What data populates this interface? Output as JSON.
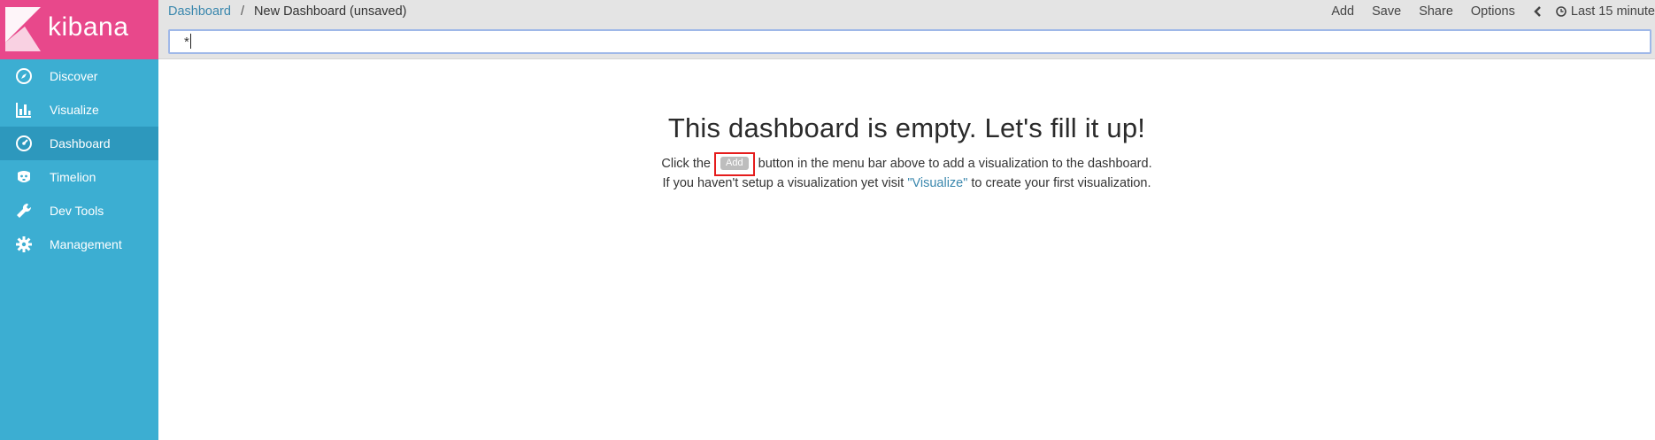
{
  "app": {
    "logo_text": "kibana"
  },
  "sidebar": {
    "items": [
      {
        "label": "Discover",
        "icon": "compass-icon"
      },
      {
        "label": "Visualize",
        "icon": "bar-chart-icon"
      },
      {
        "label": "Dashboard",
        "icon": "dashboard-icon",
        "active": true
      },
      {
        "label": "Timelion",
        "icon": "timelion-icon"
      },
      {
        "label": "Dev Tools",
        "icon": "wrench-icon"
      },
      {
        "label": "Management",
        "icon": "gear-icon"
      }
    ]
  },
  "breadcrumb": {
    "root": "Dashboard",
    "separator": "/",
    "current": "New Dashboard (unsaved)"
  },
  "menu": {
    "add": "Add",
    "save": "Save",
    "share": "Share",
    "options": "Options",
    "time": "Last 15 minute"
  },
  "query": {
    "value": "*"
  },
  "empty": {
    "title": "This dashboard is empty. Let's fill it up!",
    "line1_before": "Click the",
    "add_chip": "Add",
    "line1_after": "button in the menu bar above to add a visualization to the dashboard.",
    "line2_before": "If you haven't setup a visualization yet visit",
    "visualize_link": "\"Visualize\"",
    "line2_after": "to create your first visualization."
  },
  "colors": {
    "sidebar": "#3caed2",
    "sidebar_active": "#2d98bd",
    "logo_bg": "#e8488b",
    "link": "#3a87ad",
    "highlight": "#e51c1c"
  }
}
